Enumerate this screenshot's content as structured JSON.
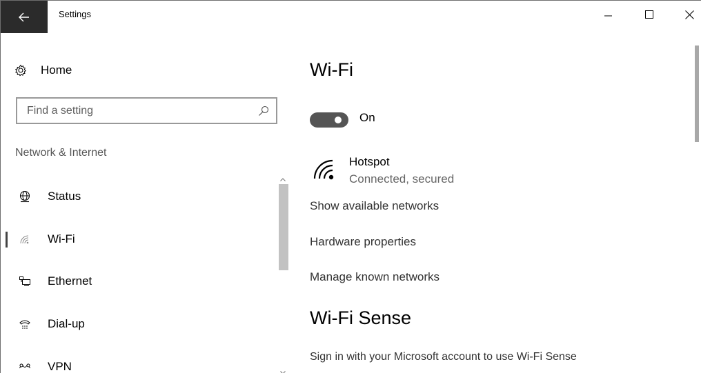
{
  "window": {
    "title": "Settings",
    "controls": {
      "minimize": "minimize-icon",
      "maximize": "maximize-icon",
      "close": "close-icon"
    },
    "back_icon": "back-arrow-icon"
  },
  "sidebar": {
    "home_label": "Home",
    "search_placeholder": "Find a setting",
    "section_label": "Network & Internet",
    "selected_index": 1,
    "items": [
      {
        "label": "Status",
        "icon": "globe-icon"
      },
      {
        "label": "Wi-Fi",
        "icon": "wifi-icon"
      },
      {
        "label": "Ethernet",
        "icon": "ethernet-icon"
      },
      {
        "label": "Dial-up",
        "icon": "dial-up-icon"
      },
      {
        "label": "VPN",
        "icon": "vpn-icon"
      }
    ]
  },
  "main": {
    "title": "Wi-Fi",
    "toggle": {
      "state_label": "On",
      "is_on": true
    },
    "network": {
      "name": "Hotspot",
      "status": "Connected, secured"
    },
    "links": [
      "Show available networks",
      "Hardware properties",
      "Manage known networks"
    ],
    "wifi_sense": {
      "title": "Wi-Fi Sense",
      "text": "Sign in with your Microsoft account to use Wi-Fi Sense"
    }
  },
  "colors": {
    "titlebar_back_bg": "#2b2b2b",
    "toggle_on": "#555555",
    "selected_indicator": "#444444"
  }
}
